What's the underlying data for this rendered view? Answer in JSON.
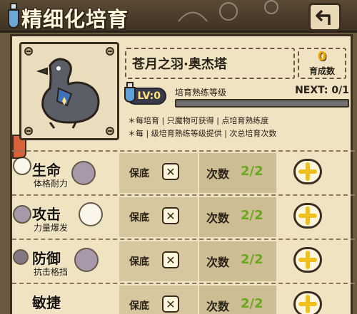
{
  "header": {
    "title": "精细化培育",
    "back_icon": "back-arrow-icon"
  },
  "character": {
    "name": "苍月之羽·奥杰塔",
    "growth_count": "0",
    "growth_label": "育成数"
  },
  "level": {
    "badge": "LV:0",
    "label": "培育熟练等级",
    "next": "NEXT: 0/1",
    "progress": 0
  },
  "notes": [
    "＊每培育 | 只魔物可获得 | 点培育熟练度",
    "＊每 | 级培育熟练等级提供 | 次总培育次数"
  ],
  "stats": [
    {
      "name": "生命",
      "sub": "体格耐力",
      "baodi": "保底",
      "cishu": "次数",
      "count": "2/2"
    },
    {
      "name": "攻击",
      "sub": "力量爆发",
      "baodi": "保底",
      "cishu": "次数",
      "count": "2/2"
    },
    {
      "name": "防御",
      "sub": "抗击格挡",
      "baodi": "保底",
      "cishu": "次数",
      "count": "2/2"
    },
    {
      "name": "敏捷",
      "sub": "",
      "baodi": "保底",
      "cishu": "次数",
      "count": "2/2"
    }
  ],
  "colors": {
    "accent_yellow": "#f0a800",
    "count_green": "#6aa61f",
    "parchment": "#efe3c2"
  }
}
